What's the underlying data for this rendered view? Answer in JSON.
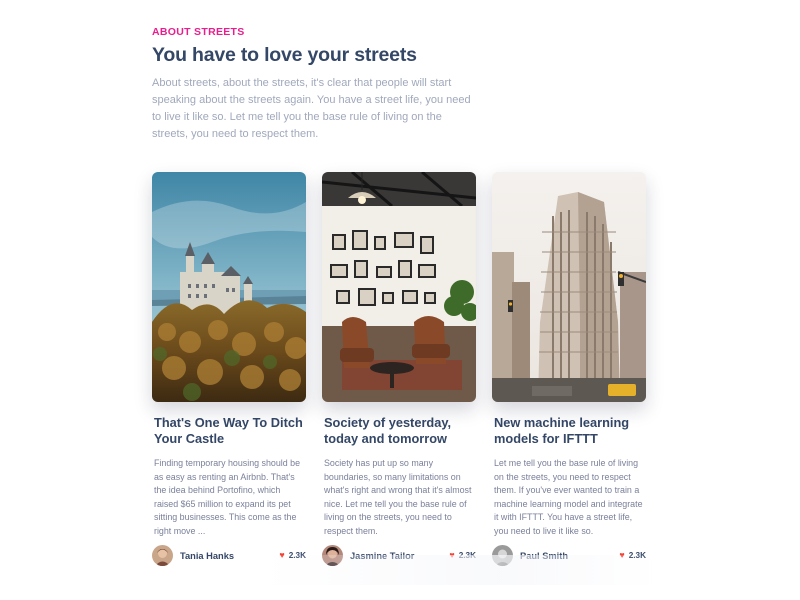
{
  "section": {
    "eyebrow": "ABOUT STREETS",
    "heading": "You have to love your streets",
    "lead": "About streets, about the streets, it's clear that people will start speaking about the streets again. You have a street life, you need to live it like so. Let me tell you the base rule of living on the streets, you need to respect them."
  },
  "cards": [
    {
      "image": "castle-photo",
      "title": "That's One Way To Ditch Your Castle",
      "description": "Finding temporary housing should be as easy as renting an Airbnb. That's the idea behind Portofino, which raised $65 million to expand its pet sitting businesses. This come as the right move ...",
      "author": "Tania Hanks",
      "likes": "2.3K"
    },
    {
      "image": "interior-photo",
      "title": "Society of yesterday, today and tomorrow",
      "description": "Society has put up so many boundaries, so many limitations on what's right and wrong that it's almost nice. Let me tell you the base rule of living on the streets, you need to respect them.",
      "author": "Jasmine Tailor",
      "likes": "2.3K"
    },
    {
      "image": "flatiron-photo",
      "title": "New machine learning models for IFTTT",
      "description": "Let me tell you the base rule of living on the streets, you need to respect them. If you've ever wanted to train a machine learning model and integrate it with IFTTT. You have a street life, you need to live it like so.",
      "author": "Paul Smith",
      "likes": "2.3K"
    }
  ],
  "icons": {
    "like": "heart-icon"
  },
  "colors": {
    "accent": "#e91e8c",
    "heading": "#344767",
    "muted": "#7b809a",
    "heart": "#f44335"
  }
}
